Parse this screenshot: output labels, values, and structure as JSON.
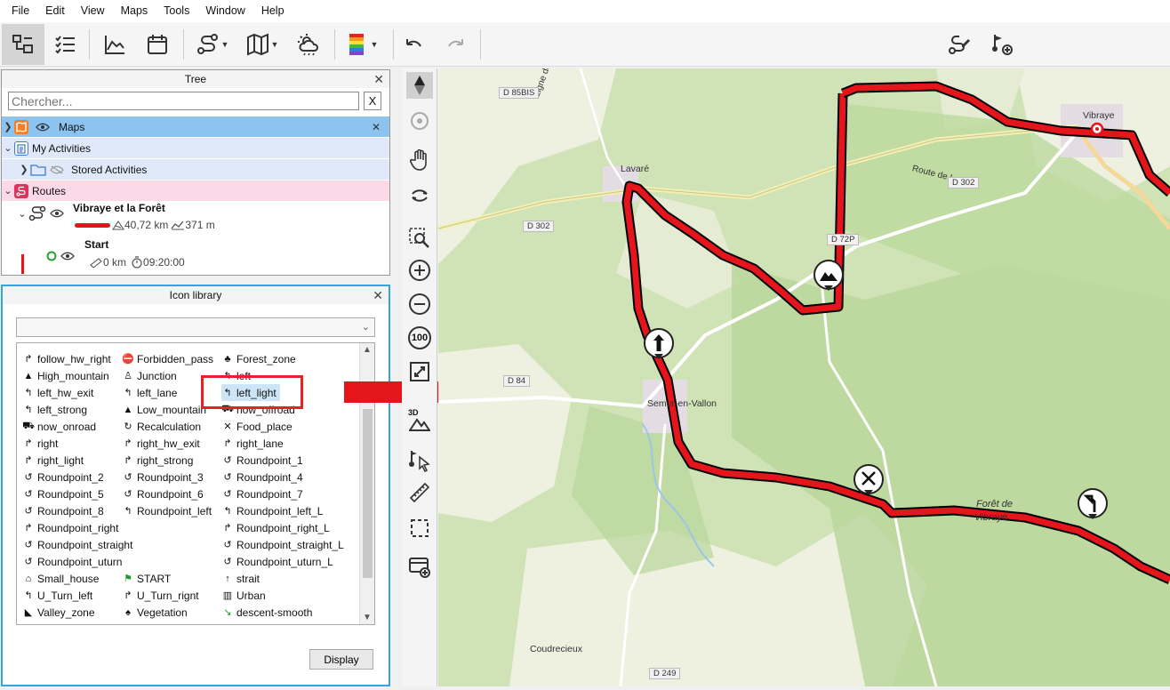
{
  "menu": [
    "File",
    "Edit",
    "View",
    "Maps",
    "Tools",
    "Window",
    "Help"
  ],
  "toolbar": {
    "icons": [
      "tree-view-icon",
      "checklist-icon",
      "chart-icon",
      "calendar-icon",
      "route-icon",
      "map-icon",
      "weather-icon",
      "color-scale-icon",
      "undo-icon",
      "redo-icon",
      "route-edit-icon",
      "add-waypoint-icon"
    ]
  },
  "tree": {
    "title": "Tree",
    "search_placeholder": "Chercher...",
    "search_clear": "X",
    "nodes": {
      "maps": "Maps",
      "my_activities": "My Activities",
      "stored_activities": "Stored Activities",
      "routes": "Routes",
      "route_name": "Vibraye et la Forêt",
      "route_distance": "40,72 km",
      "route_elevation": "371 m",
      "start_label": "Start",
      "start_distance": "0 km",
      "start_time": "09:20:00"
    }
  },
  "library": {
    "title": "Icon library",
    "select_value": "",
    "display_button": "Display",
    "items": [
      [
        "follow_hw_right",
        "Forbidden_pass",
        "Forest_zone"
      ],
      [
        "High_mountain",
        "Junction",
        "left"
      ],
      [
        "left_hw_exit",
        "left_lane",
        "left_light"
      ],
      [
        "left_strong",
        "Low_mountain",
        "now_offroad"
      ],
      [
        "now_onroad",
        "Recalculation",
        "Food_place"
      ],
      [
        "right",
        "right_hw_exit",
        "right_lane"
      ],
      [
        "right_light",
        "right_strong",
        "Roundpoint_1"
      ],
      [
        "Roundpoint_2",
        "Roundpoint_3",
        "Roundpoint_4"
      ],
      [
        "Roundpoint_5",
        "Roundpoint_6",
        "Roundpoint_7"
      ],
      [
        "Roundpoint_8",
        "Roundpoint_left",
        "Roundpoint_left_L"
      ],
      [
        "Roundpoint_right",
        "",
        "Roundpoint_right_L"
      ],
      [
        "Roundpoint_straight",
        "",
        "Roundpoint_straight_L"
      ],
      [
        "Roundpoint_uturn",
        "",
        "Roundpoint_uturn_L"
      ],
      [
        "Small_house",
        "START",
        "strait"
      ],
      [
        "U_Turn_left",
        "U_Turn_rignt",
        "Urban"
      ],
      [
        "Valley_zone",
        "Vegetation",
        "descent-smooth"
      ]
    ],
    "selected": "left_light"
  },
  "map": {
    "labels": {
      "vibraye": "Vibraye",
      "lavare": "Lavaré",
      "semur": "Semur-en-Vallon",
      "coudrecieux": "Coudrecieux",
      "route_lavare": "Route de Lavaré",
      "ligne": "Ligne de",
      "foret1": "Forêt de",
      "foret2": "Vibraye"
    },
    "roads": [
      "D 85BIS",
      "D 302",
      "D 302",
      "D 72P",
      "D 84",
      "D 249"
    ],
    "route_color": "#e4151b",
    "tools": [
      "compass-icon",
      "locate-icon",
      "pan-hand-icon",
      "rotate-icon",
      "zoom-area-icon",
      "zoom-in-icon",
      "zoom-out-icon",
      "zoom-100-icon",
      "fit-icon",
      "3d-icon",
      "select-point-icon",
      "ruler-icon",
      "select-rect-icon",
      "add-layer-icon"
    ],
    "zoom_100": "100",
    "three_d": "3D"
  }
}
